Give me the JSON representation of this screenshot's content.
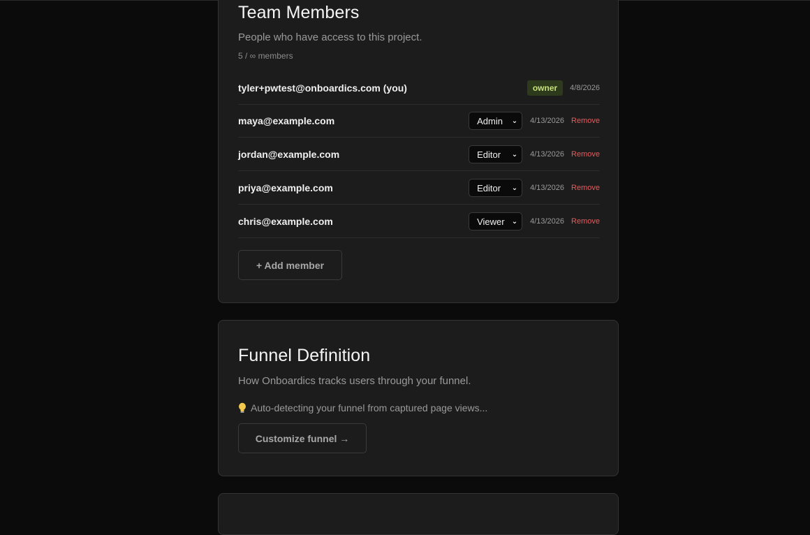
{
  "team": {
    "title": "Team Members",
    "subtitle": "People who have access to this project.",
    "count": "5 / ∞ members",
    "members": [
      {
        "email": "tyler+pwtest@onboardics.com (you)",
        "badge": "owner",
        "date": "4/8/2026"
      },
      {
        "email": "maya@example.com",
        "role": "Admin",
        "date": "4/13/2026",
        "action": "Remove"
      },
      {
        "email": "jordan@example.com",
        "role": "Editor",
        "date": "4/13/2026",
        "action": "Remove"
      },
      {
        "email": "priya@example.com",
        "role": "Editor",
        "date": "4/13/2026",
        "action": "Remove"
      },
      {
        "email": "chris@example.com",
        "role": "Viewer",
        "date": "4/13/2026",
        "action": "Remove"
      }
    ],
    "add_button": "+ Add member"
  },
  "funnel": {
    "title": "Funnel Definition",
    "subtitle": "How Onboardics tracks users through your funnel.",
    "hint": "Auto-detecting your funnel from captured page views...",
    "hint_icon": "lightbulb-icon",
    "button": "Customize funnel →"
  },
  "colors": {
    "background": "#0b0b0b",
    "card": "#1c1c1c",
    "owner_badge_bg": "#2e3a1c",
    "owner_badge_text": "#c8e07a",
    "remove": "#e35d5d"
  }
}
